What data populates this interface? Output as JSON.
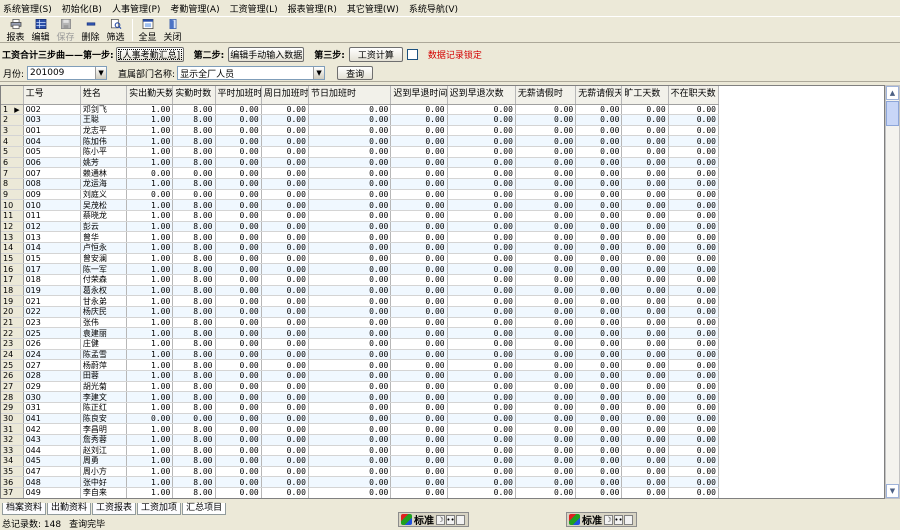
{
  "menu": [
    "系统管理(S)",
    "初始化(B)",
    "人事管理(P)",
    "考勤管理(A)",
    "工资管理(L)",
    "报表管理(R)",
    "其它管理(W)",
    "系统导航(V)"
  ],
  "toolbar": {
    "buttons": [
      {
        "label": "报表",
        "icon": "printer-icon",
        "enabled": true
      },
      {
        "label": "编辑",
        "icon": "edit-grid-icon",
        "enabled": true
      },
      {
        "label": "保存",
        "icon": "save-icon",
        "enabled": false
      },
      {
        "label": "删除",
        "icon": "delete-icon",
        "enabled": true
      },
      {
        "label": "筛选",
        "icon": "filter-icon",
        "enabled": true
      },
      {
        "label": "全显",
        "icon": "show-all-icon",
        "enabled": true
      },
      {
        "label": "关闭",
        "icon": "close-door-icon",
        "enabled": true
      }
    ]
  },
  "steps": {
    "title": "工资合计三步曲——第一步:",
    "step1_button": "[人事考勤汇总]",
    "step2_label": "第二步:",
    "step2_button": "编辑手动输入数据",
    "step3_label": "第三步:",
    "step3_button": "工资计算",
    "lock_label": "数据记录锁定"
  },
  "filters": {
    "month_label": "月份:",
    "month_value": "201009",
    "dept_label": "直属部门名称:",
    "dept_value": "显示全厂人员",
    "query_button": "查询"
  },
  "grid": {
    "columns": [
      "工号",
      "姓名",
      "实出勤天数",
      "实勤时数",
      "平时加班时",
      "周日加班时",
      "节日加班时",
      "迟到早退时间",
      "迟到早退次数",
      "无薪请假时",
      "无薪请假天",
      "旷工天数",
      "不在职天数"
    ],
    "rows": [
      [
        "1",
        "002",
        "邓剑飞",
        "1.00",
        "8.00",
        "0.00",
        "0.00",
        "0.00",
        "0.00",
        "0.00",
        "0.00",
        "0.00",
        "0.00",
        "0.00"
      ],
      [
        "2",
        "003",
        "王聪",
        "1.00",
        "8.00",
        "0.00",
        "0.00",
        "0.00",
        "0.00",
        "0.00",
        "0.00",
        "0.00",
        "0.00",
        "0.00"
      ],
      [
        "3",
        "001",
        "龙志平",
        "1.00",
        "8.00",
        "0.00",
        "0.00",
        "0.00",
        "0.00",
        "0.00",
        "0.00",
        "0.00",
        "0.00",
        "0.00"
      ],
      [
        "4",
        "004",
        "陈加伟",
        "1.00",
        "8.00",
        "0.00",
        "0.00",
        "0.00",
        "0.00",
        "0.00",
        "0.00",
        "0.00",
        "0.00",
        "0.00"
      ],
      [
        "5",
        "005",
        "陈小平",
        "1.00",
        "8.00",
        "0.00",
        "0.00",
        "0.00",
        "0.00",
        "0.00",
        "0.00",
        "0.00",
        "0.00",
        "0.00"
      ],
      [
        "6",
        "006",
        "姚芳",
        "1.00",
        "8.00",
        "0.00",
        "0.00",
        "0.00",
        "0.00",
        "0.00",
        "0.00",
        "0.00",
        "0.00",
        "0.00"
      ],
      [
        "7",
        "007",
        "赖通林",
        "0.00",
        "0.00",
        "0.00",
        "0.00",
        "0.00",
        "0.00",
        "0.00",
        "0.00",
        "0.00",
        "0.00",
        "0.00"
      ],
      [
        "8",
        "008",
        "龙运海",
        "1.00",
        "8.00",
        "0.00",
        "0.00",
        "0.00",
        "0.00",
        "0.00",
        "0.00",
        "0.00",
        "0.00",
        "0.00"
      ],
      [
        "9",
        "009",
        "刘庭义",
        "0.00",
        "0.00",
        "0.00",
        "0.00",
        "0.00",
        "0.00",
        "0.00",
        "0.00",
        "0.00",
        "0.00",
        "0.00"
      ],
      [
        "10",
        "010",
        "吴茂松",
        "1.00",
        "8.00",
        "0.00",
        "0.00",
        "0.00",
        "0.00",
        "0.00",
        "0.00",
        "0.00",
        "0.00",
        "0.00"
      ],
      [
        "11",
        "011",
        "蔡晓龙",
        "1.00",
        "8.00",
        "0.00",
        "0.00",
        "0.00",
        "0.00",
        "0.00",
        "0.00",
        "0.00",
        "0.00",
        "0.00"
      ],
      [
        "12",
        "012",
        "彭云",
        "1.00",
        "8.00",
        "0.00",
        "0.00",
        "0.00",
        "0.00",
        "0.00",
        "0.00",
        "0.00",
        "0.00",
        "0.00"
      ],
      [
        "13",
        "013",
        "曾华",
        "1.00",
        "8.00",
        "0.00",
        "0.00",
        "0.00",
        "0.00",
        "0.00",
        "0.00",
        "0.00",
        "0.00",
        "0.00"
      ],
      [
        "14",
        "014",
        "卢恒永",
        "1.00",
        "8.00",
        "0.00",
        "0.00",
        "0.00",
        "0.00",
        "0.00",
        "0.00",
        "0.00",
        "0.00",
        "0.00"
      ],
      [
        "15",
        "015",
        "曾安澜",
        "1.00",
        "8.00",
        "0.00",
        "0.00",
        "0.00",
        "0.00",
        "0.00",
        "0.00",
        "0.00",
        "0.00",
        "0.00"
      ],
      [
        "16",
        "017",
        "陈一军",
        "1.00",
        "8.00",
        "0.00",
        "0.00",
        "0.00",
        "0.00",
        "0.00",
        "0.00",
        "0.00",
        "0.00",
        "0.00"
      ],
      [
        "17",
        "018",
        "付荣森",
        "1.00",
        "8.00",
        "0.00",
        "0.00",
        "0.00",
        "0.00",
        "0.00",
        "0.00",
        "0.00",
        "0.00",
        "0.00"
      ],
      [
        "18",
        "019",
        "葛永权",
        "1.00",
        "8.00",
        "0.00",
        "0.00",
        "0.00",
        "0.00",
        "0.00",
        "0.00",
        "0.00",
        "0.00",
        "0.00"
      ],
      [
        "19",
        "021",
        "甘永弟",
        "1.00",
        "8.00",
        "0.00",
        "0.00",
        "0.00",
        "0.00",
        "0.00",
        "0.00",
        "0.00",
        "0.00",
        "0.00"
      ],
      [
        "20",
        "022",
        "杨庆民",
        "1.00",
        "8.00",
        "0.00",
        "0.00",
        "0.00",
        "0.00",
        "0.00",
        "0.00",
        "0.00",
        "0.00",
        "0.00"
      ],
      [
        "21",
        "023",
        "张伟",
        "1.00",
        "8.00",
        "0.00",
        "0.00",
        "0.00",
        "0.00",
        "0.00",
        "0.00",
        "0.00",
        "0.00",
        "0.00"
      ],
      [
        "22",
        "025",
        "袁建丽",
        "1.00",
        "8.00",
        "0.00",
        "0.00",
        "0.00",
        "0.00",
        "0.00",
        "0.00",
        "0.00",
        "0.00",
        "0.00"
      ],
      [
        "23",
        "026",
        "庄健",
        "1.00",
        "8.00",
        "0.00",
        "0.00",
        "0.00",
        "0.00",
        "0.00",
        "0.00",
        "0.00",
        "0.00",
        "0.00"
      ],
      [
        "24",
        "024",
        "陈孟雪",
        "1.00",
        "8.00",
        "0.00",
        "0.00",
        "0.00",
        "0.00",
        "0.00",
        "0.00",
        "0.00",
        "0.00",
        "0.00"
      ],
      [
        "25",
        "027",
        "杨蔚萍",
        "1.00",
        "8.00",
        "0.00",
        "0.00",
        "0.00",
        "0.00",
        "0.00",
        "0.00",
        "0.00",
        "0.00",
        "0.00"
      ],
      [
        "26",
        "028",
        "田蓉",
        "1.00",
        "8.00",
        "0.00",
        "0.00",
        "0.00",
        "0.00",
        "0.00",
        "0.00",
        "0.00",
        "0.00",
        "0.00"
      ],
      [
        "27",
        "029",
        "胡光菊",
        "1.00",
        "8.00",
        "0.00",
        "0.00",
        "0.00",
        "0.00",
        "0.00",
        "0.00",
        "0.00",
        "0.00",
        "0.00"
      ],
      [
        "28",
        "030",
        "李建文",
        "1.00",
        "8.00",
        "0.00",
        "0.00",
        "0.00",
        "0.00",
        "0.00",
        "0.00",
        "0.00",
        "0.00",
        "0.00"
      ],
      [
        "29",
        "031",
        "陈正红",
        "1.00",
        "8.00",
        "0.00",
        "0.00",
        "0.00",
        "0.00",
        "0.00",
        "0.00",
        "0.00",
        "0.00",
        "0.00"
      ],
      [
        "30",
        "041",
        "陈良安",
        "0.00",
        "0.00",
        "0.00",
        "0.00",
        "0.00",
        "0.00",
        "0.00",
        "0.00",
        "0.00",
        "0.00",
        "0.00"
      ],
      [
        "31",
        "042",
        "李昌明",
        "1.00",
        "8.00",
        "0.00",
        "0.00",
        "0.00",
        "0.00",
        "0.00",
        "0.00",
        "0.00",
        "0.00",
        "0.00"
      ],
      [
        "32",
        "043",
        "詹秀蓉",
        "1.00",
        "8.00",
        "0.00",
        "0.00",
        "0.00",
        "0.00",
        "0.00",
        "0.00",
        "0.00",
        "0.00",
        "0.00"
      ],
      [
        "33",
        "044",
        "赵刘江",
        "1.00",
        "8.00",
        "0.00",
        "0.00",
        "0.00",
        "0.00",
        "0.00",
        "0.00",
        "0.00",
        "0.00",
        "0.00"
      ],
      [
        "34",
        "045",
        "周勇",
        "1.00",
        "8.00",
        "0.00",
        "0.00",
        "0.00",
        "0.00",
        "0.00",
        "0.00",
        "0.00",
        "0.00",
        "0.00"
      ],
      [
        "35",
        "047",
        "周小方",
        "1.00",
        "8.00",
        "0.00",
        "0.00",
        "0.00",
        "0.00",
        "0.00",
        "0.00",
        "0.00",
        "0.00",
        "0.00"
      ],
      [
        "36",
        "048",
        "张中好",
        "1.00",
        "8.00",
        "0.00",
        "0.00",
        "0.00",
        "0.00",
        "0.00",
        "0.00",
        "0.00",
        "0.00",
        "0.00"
      ],
      [
        "37",
        "049",
        "李自来",
        "1.00",
        "8.00",
        "0.00",
        "0.00",
        "0.00",
        "0.00",
        "0.00",
        "0.00",
        "0.00",
        "0.00",
        "0.00"
      ]
    ]
  },
  "tabs": [
    "档案资料",
    "出勤资料",
    "工资报表",
    "工资加项",
    "汇总项目"
  ],
  "active_tab": 4,
  "status": {
    "record_count": "总记录数: 148",
    "message": "查询完毕"
  },
  "ime": {
    "label": "标准",
    "moon": "☽",
    "dots": "••"
  }
}
